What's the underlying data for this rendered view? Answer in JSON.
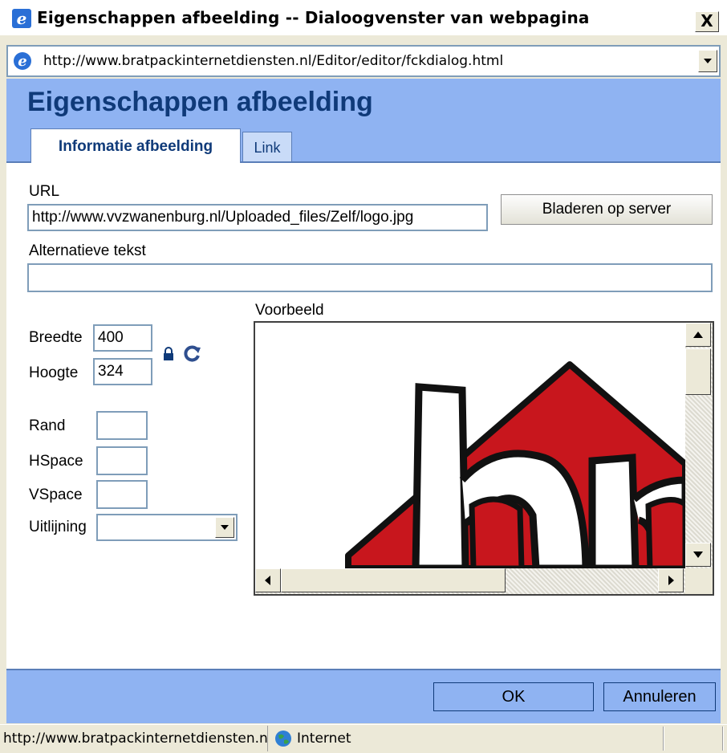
{
  "window": {
    "title": "Eigenschappen afbeelding -- Dialoogvenster van webpagina",
    "close_glyph": "X",
    "address": "http://www.bratpackinternetdiensten.nl/Editor/editor/fckdialog.html"
  },
  "dialog": {
    "heading": "Eigenschappen afbeelding",
    "tabs": [
      {
        "label": "Informatie afbeelding",
        "selected": true
      },
      {
        "label": "Link",
        "selected": false
      }
    ],
    "url_label": "URL",
    "url_value": "http://www.vvzwanenburg.nl/Uploaded_files/Zelf/logo.jpg",
    "browse_button": "Bladeren op server",
    "alt_label": "Alternatieve tekst",
    "alt_value": "",
    "width_label": "Breedte",
    "width_value": "400",
    "height_label": "Hoogte",
    "height_value": "324",
    "border_label": "Rand",
    "border_value": "",
    "hspace_label": "HSpace",
    "hspace_value": "",
    "vspace_label": "VSpace",
    "vspace_value": "",
    "align_label": "Uitlijning",
    "align_value": "",
    "preview_label": "Voorbeeld",
    "ok_button": "OK",
    "cancel_button": "Annuleren"
  },
  "status": {
    "text": "http://www.bratpackinternetdiensten.nl/Editor/editor/fckdialog.html",
    "zone": "Internet"
  },
  "colors": {
    "dialog_blue": "#8fb3f2",
    "heading_blue": "#0f3a79",
    "logo_red": "#c8161d"
  },
  "icons": [
    "ie-icon",
    "close-icon",
    "dropdown-arrow-icon",
    "lock-icon",
    "reset-size-icon",
    "scroll-up-icon",
    "scroll-down-icon",
    "scroll-left-icon",
    "scroll-right-icon",
    "globe-icon"
  ]
}
